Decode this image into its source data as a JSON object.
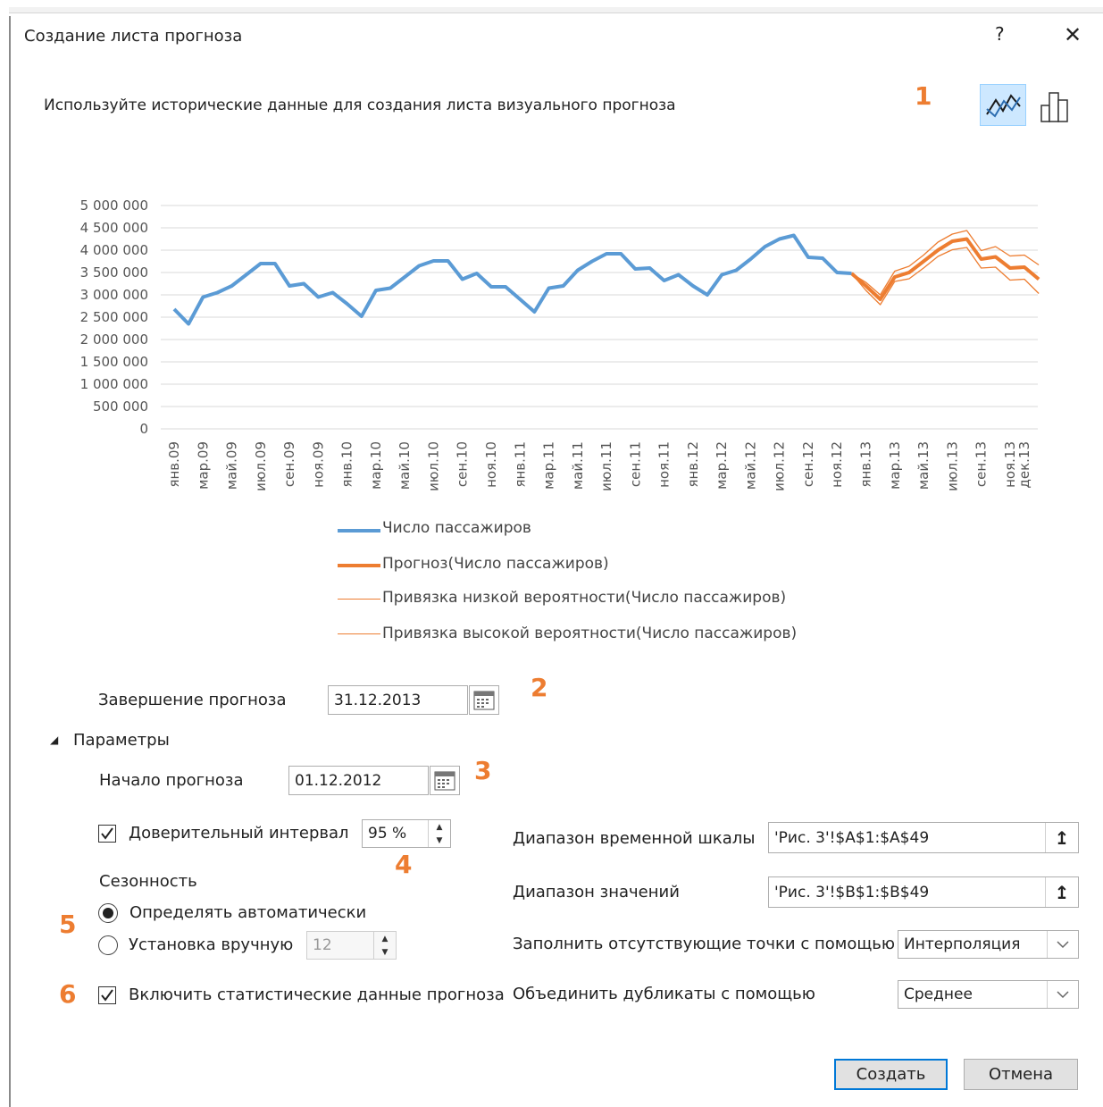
{
  "dialog": {
    "title": "Создание листа прогноза",
    "help": "?",
    "close": "✕",
    "subtitle": "Используйте исторические данные для создания листа визуального прогноза"
  },
  "badges": [
    "1",
    "2",
    "3",
    "4",
    "5",
    "6"
  ],
  "chart_types": [
    {
      "name": "line-chart-icon",
      "selected": true
    },
    {
      "name": "column-chart-icon",
      "selected": false
    }
  ],
  "colors": {
    "history": "#5b9bd5",
    "forecast": "#ed7d31",
    "accent": "#0078d7",
    "badge": "#ed7d31"
  },
  "chart_data": {
    "type": "line",
    "ylim": [
      0,
      5000000
    ],
    "yticks": [
      "5 000 000",
      "4 500 000",
      "4 000 000",
      "3 500 000",
      "3 000 000",
      "2 500 000",
      "2 000 000",
      "1 500 000",
      "1 000 000",
      "500 000",
      "0"
    ],
    "ytick_values": [
      5000000,
      4500000,
      4000000,
      3500000,
      3000000,
      2500000,
      2000000,
      1500000,
      1000000,
      500000,
      0
    ],
    "xticks": [
      "янв.09",
      "мар.09",
      "май.09",
      "июл.09",
      "сен.09",
      "ноя.09",
      "янв.10",
      "мар.10",
      "май.10",
      "июл.10",
      "сен.10",
      "ноя.10",
      "янв.11",
      "мар.11",
      "май.11",
      "июл.11",
      "сен.11",
      "ноя.11",
      "янв.12",
      "мар.12",
      "май.12",
      "июл.12",
      "сен.12",
      "ноя.12",
      "янв.13",
      "мар.13",
      "май.13",
      "июл.13",
      "сен.13",
      "ноя.13",
      "дек.13"
    ],
    "x_months_total": 60,
    "series": [
      {
        "name": "Число пассажиров",
        "start_month": 0,
        "values": [
          2680000,
          2350000,
          2950000,
          3050000,
          3200000,
          3450000,
          3700000,
          3700000,
          3200000,
          3250000,
          2950000,
          3050000,
          2800000,
          2520000,
          3100000,
          3150000,
          3400000,
          3650000,
          3760000,
          3760000,
          3350000,
          3480000,
          3180000,
          3180000,
          2900000,
          2620000,
          3150000,
          3200000,
          3550000,
          3750000,
          3920000,
          3920000,
          3580000,
          3600000,
          3320000,
          3450000,
          3200000,
          3000000,
          3450000,
          3550000,
          3800000,
          4080000,
          4250000,
          4330000,
          3840000,
          3820000,
          3500000,
          3480000
        ]
      },
      {
        "name": "Прогноз(Число пассажиров)",
        "start_month": 47,
        "values": [
          3480000,
          3200000,
          2900000,
          3400000,
          3500000,
          3750000,
          4000000,
          4200000,
          4250000,
          3800000,
          3850000,
          3600000,
          3620000,
          3350000
        ]
      },
      {
        "name": "Привязка низкой вероятности(Число пассажиров)",
        "start_month": 47,
        "values": [
          3480000,
          3100000,
          2780000,
          3300000,
          3360000,
          3600000,
          3860000,
          4010000,
          4060000,
          3600000,
          3620000,
          3330000,
          3350000,
          3030000
        ]
      },
      {
        "name": "Привязка высокой вероятности(Число пассажиров)",
        "start_month": 47,
        "values": [
          3480000,
          3280000,
          3000000,
          3530000,
          3640000,
          3890000,
          4180000,
          4360000,
          4440000,
          3990000,
          4080000,
          3870000,
          3890000,
          3670000
        ]
      }
    ],
    "grid": true,
    "legend_position": "bottom"
  },
  "legend": [
    {
      "label": "Число пассажиров"
    },
    {
      "label": "Прогноз(Число пассажиров)"
    },
    {
      "label": "Привязка низкой вероятности(Число пассажиров)"
    },
    {
      "label": "Привязка высокой вероятности(Число пассажиров)"
    }
  ],
  "form": {
    "forecast_end_label": "Завершение прогноза",
    "forecast_end_value": "31.12.2013",
    "options_label": "Параметры",
    "forecast_start_label": "Начало прогноза",
    "forecast_start_value": "01.12.2012",
    "confidence_label": "Доверительный интервал",
    "confidence_value": "95 %",
    "seasonality_label": "Сезонность",
    "auto_label": "Определять автоматически",
    "manual_label": "Установка вручную",
    "manual_value": "12",
    "stats_label": "Включить статистические данные прогноза",
    "timeline_label": "Диапазон временной шкалы",
    "timeline_value": "'Рис. 3'!$A$1:$A$49",
    "values_label": "Диапазон значений",
    "values_value": "'Рис. 3'!$B$1:$B$49",
    "fill_label": "Заполнить отсутствующие точки с помощью",
    "fill_value": "Интерполяция",
    "dups_label": "Объединить дубликаты с помощью",
    "dups_value": "Среднее",
    "create_label": "Создать",
    "cancel_label": "Отмена"
  }
}
